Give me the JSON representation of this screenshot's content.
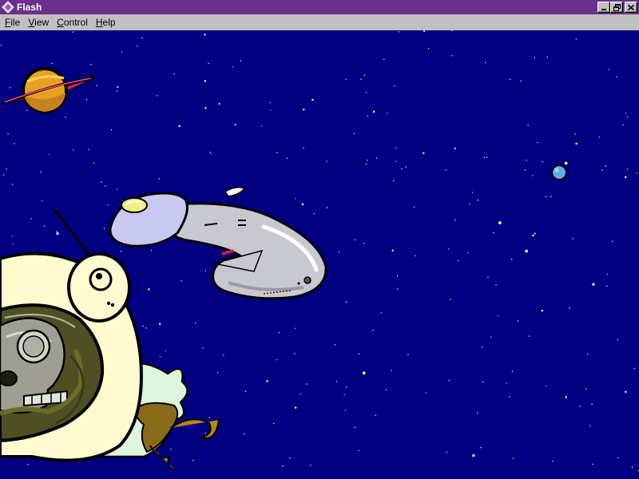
{
  "window": {
    "title": "Flash",
    "titlebar_color": "#6b2f8c",
    "stage_color": "#000080"
  },
  "titlebar_buttons": [
    {
      "name": "minimize-button",
      "icon": "minimize-icon"
    },
    {
      "name": "restore-button",
      "icon": "restore-icon"
    },
    {
      "name": "close-button",
      "icon": "close-icon"
    }
  ],
  "menu": {
    "items": [
      {
        "accel": "F",
        "rest": "ile"
      },
      {
        "accel": "V",
        "rest": "iew"
      },
      {
        "accel": "C",
        "rest": "ontrol"
      },
      {
        "accel": "H",
        "rest": "elp"
      }
    ]
  },
  "scene": {
    "objects": [
      "ringed-planet",
      "blue-planet",
      "spaceship",
      "astronaut-helmet",
      "skull",
      "alien-creature"
    ],
    "colors": {
      "planet_orange": "#e8a020",
      "planet_ring": "#cc2266",
      "blue_planet": "#5ab0e0",
      "ship_hull": "#c8c8d0",
      "ship_dome": "#c8c8f0",
      "helmet": "#fffbd0",
      "alien_green": "#ddf5dd"
    }
  }
}
